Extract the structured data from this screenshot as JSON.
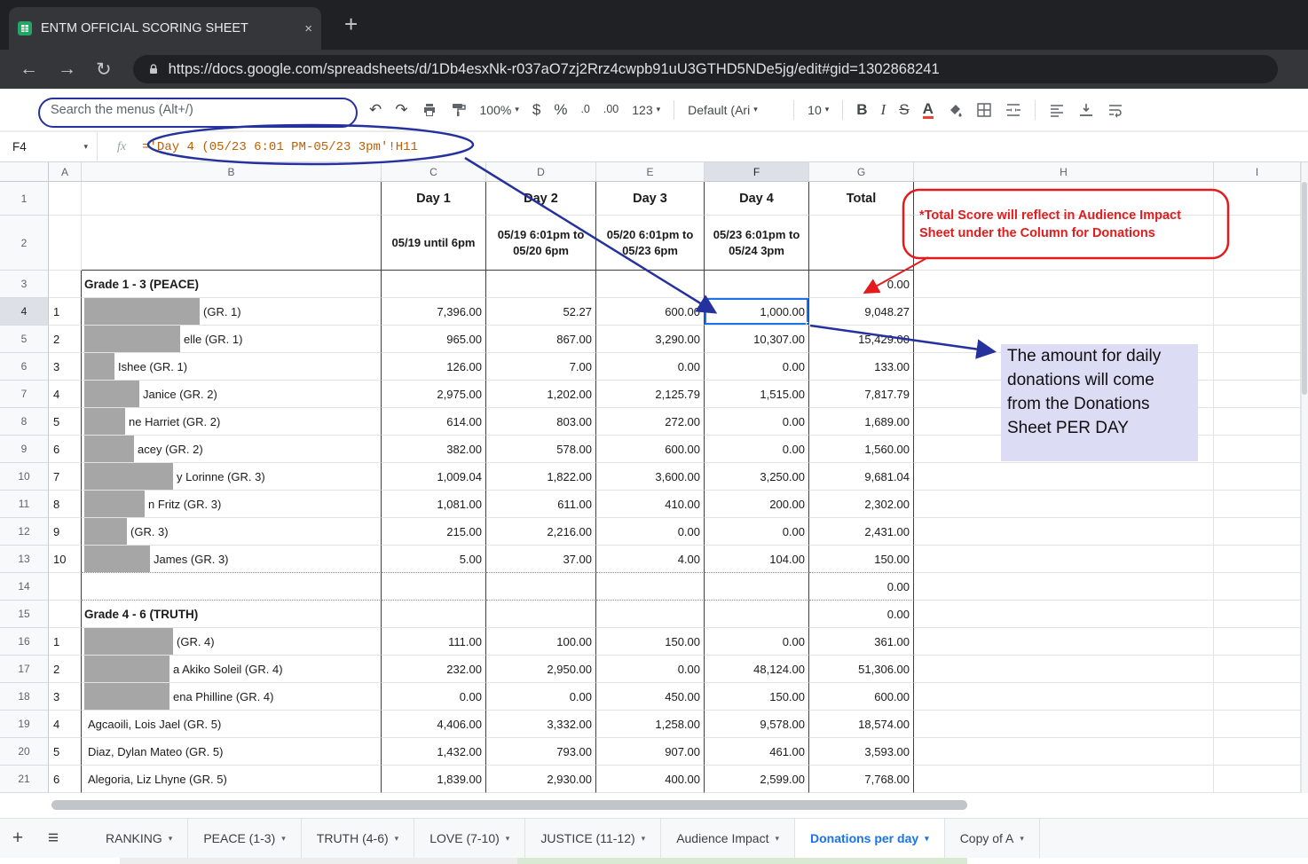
{
  "browser": {
    "tab_title": "ENTM OFFICIAL SCORING SHEET",
    "url": "https://docs.google.com/spreadsheets/d/1Db4esxNk-r037aO7zj2Rrz4cwpb91uU3GTHD5NDe5jg/edit#gid=1302868241"
  },
  "toolbar": {
    "search_placeholder": "Search the menus (Alt+/)",
    "zoom": "100%",
    "currency": "$",
    "percent": "%",
    "decrease_decimal": ".0",
    "increase_decimal": ".00",
    "number_format": "123",
    "font_family": "Default (Ari",
    "font_size": "10",
    "bold": "B",
    "italic": "I",
    "strikethrough": "S",
    "text_color": "A"
  },
  "formula_bar": {
    "cell_ref": "F4",
    "formula": "='Day 4 (05/23 6:01 PM-05/23 3pm'!H11"
  },
  "annotations": {
    "red_note": "*Total Score will reflect in Audience Impact Sheet under the Column for Donations",
    "blue_note": "The amount for daily donations will come from the Donations Sheet PER DAY"
  },
  "grid": {
    "columns": [
      "A",
      "B",
      "C",
      "D",
      "E",
      "F",
      "G",
      "H",
      "I"
    ],
    "selected_col": "F",
    "selected_row": 4,
    "rows": [
      {
        "n": 1,
        "type": "day-header",
        "cells": {
          "C": "Day 1",
          "D": "Day 2",
          "E": "Day 3",
          "F": "Day 4",
          "G": "Total"
        }
      },
      {
        "n": 2,
        "type": "date-header",
        "cells": {
          "C": "05/19 until 6pm",
          "D": "05/19 6:01pm to 05/20 6pm",
          "E": "05/20 6:01pm to 05/23 6pm",
          "F": "05/23 6:01pm to 05/24 3pm"
        }
      },
      {
        "n": 3,
        "type": "section",
        "b": "Grade 1 - 3 (PEACE)",
        "g": "0.00"
      },
      {
        "n": 4,
        "a": "1",
        "redact": 130,
        "name": "(GR. 1)",
        "c": "7,396.00",
        "d": "52.27",
        "e": "600.00",
        "f": "1,000.00",
        "g": "9,048.27",
        "selected": "F"
      },
      {
        "n": 5,
        "a": "2",
        "redact": 108,
        "name": "elle (GR. 1)",
        "c": "965.00",
        "d": "867.00",
        "e": "3,290.00",
        "f": "10,307.00",
        "g": "15,429.00"
      },
      {
        "n": 6,
        "a": "3",
        "redact": 34,
        "name": "Ishee  (GR. 1)",
        "c": "126.00",
        "d": "7.00",
        "e": "0.00",
        "f": "0.00",
        "g": "133.00"
      },
      {
        "n": 7,
        "a": "4",
        "redact": 62,
        "name": "Janice (GR. 2)",
        "c": "2,975.00",
        "d": "1,202.00",
        "e": "2,125.79",
        "f": "1,515.00",
        "g": "7,817.79"
      },
      {
        "n": 8,
        "a": "5",
        "redact": 46,
        "name": "ne Harriet  (GR. 2)",
        "c": "614.00",
        "d": "803.00",
        "e": "272.00",
        "f": "0.00",
        "g": "1,689.00"
      },
      {
        "n": 9,
        "a": "6",
        "redact": 56,
        "name": "acey  (GR. 2)",
        "c": "382.00",
        "d": "578.00",
        "e": "600.00",
        "f": "0.00",
        "g": "1,560.00"
      },
      {
        "n": 10,
        "a": "7",
        "redact": 100,
        "name": "y Lorinne  (GR. 3)",
        "c": "1,009.04",
        "d": "1,822.00",
        "e": "3,600.00",
        "f": "3,250.00",
        "g": "9,681.04"
      },
      {
        "n": 11,
        "a": "8",
        "redact": 68,
        "name": "n Fritz (GR. 3)",
        "c": "1,081.00",
        "d": "611.00",
        "e": "410.00",
        "f": "200.00",
        "g": "2,302.00"
      },
      {
        "n": 12,
        "a": "9",
        "redact": 48,
        "name": "(GR. 3)",
        "c": "215.00",
        "d": "2,216.00",
        "e": "0.00",
        "f": "0.00",
        "g": "2,431.00"
      },
      {
        "n": 13,
        "a": "10",
        "redact": 74,
        "name": "James (GR. 3)",
        "c": "5.00",
        "d": "37.00",
        "e": "4.00",
        "f": "104.00",
        "g": "150.00",
        "dotted": true
      },
      {
        "n": 14,
        "type": "blank",
        "g": "0.00",
        "dotted": true
      },
      {
        "n": 15,
        "type": "section",
        "b": "Grade 4 - 6 (TRUTH)",
        "g": "0.00"
      },
      {
        "n": 16,
        "a": "1",
        "redact": 100,
        "name": "(GR. 4)",
        "c": "111.00",
        "d": "100.00",
        "e": "150.00",
        "f": "0.00",
        "g": "361.00"
      },
      {
        "n": 17,
        "a": "2",
        "redact": 96,
        "name": "a Akiko Soleil (GR. 4)",
        "c": "232.00",
        "d": "2,950.00",
        "e": "0.00",
        "f": "48,124.00",
        "g": "51,306.00"
      },
      {
        "n": 18,
        "a": "3",
        "redact": 96,
        "name": "ena Philline  (GR. 4)",
        "c": "0.00",
        "d": "0.00",
        "e": "450.00",
        "f": "150.00",
        "g": "600.00"
      },
      {
        "n": 19,
        "a": "4",
        "name": "Agcaoili, Lois Jael (GR. 5)",
        "c": "4,406.00",
        "d": "3,332.00",
        "e": "1,258.00",
        "f": "9,578.00",
        "g": "18,574.00"
      },
      {
        "n": 20,
        "a": "5",
        "name": "Diaz, Dylan Mateo (GR. 5)",
        "c": "1,432.00",
        "d": "793.00",
        "e": "907.00",
        "f": "461.00",
        "g": "3,593.00"
      },
      {
        "n": 21,
        "a": "6",
        "name": "Alegoria, Liz Lhyne (GR. 5)",
        "c": "1,839.00",
        "d": "2,930.00",
        "e": "400.00",
        "f": "2,599.00",
        "g": "7,768.00"
      }
    ]
  },
  "sheet_tabs": [
    {
      "label": "RANKING"
    },
    {
      "label": "PEACE (1-3)"
    },
    {
      "label": "TRUTH (4-6)"
    },
    {
      "label": "LOVE (7-10)"
    },
    {
      "label": "JUSTICE (11-12)"
    },
    {
      "label": "Audience Impact"
    },
    {
      "label": "Donations per day",
      "active": true
    },
    {
      "label": "Copy of A"
    }
  ]
}
